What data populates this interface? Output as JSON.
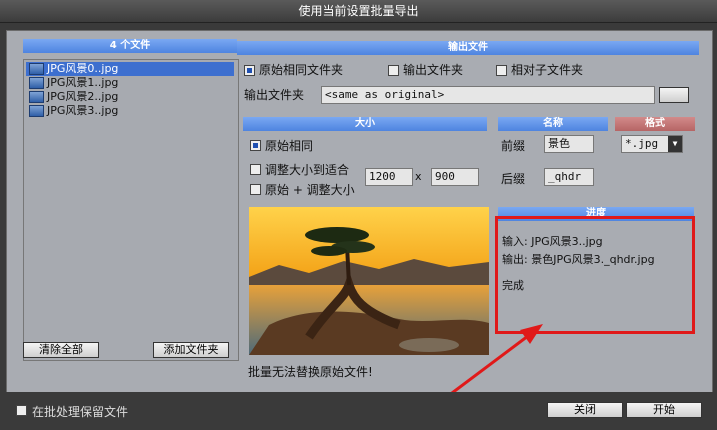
{
  "window": {
    "title": "使用当前设置批量导出"
  },
  "files": {
    "header": "4 个文件",
    "items": [
      {
        "label": "JPG风景0..jpg",
        "selected": true
      },
      {
        "label": "JPG风景1..jpg",
        "selected": false
      },
      {
        "label": "JPG风景2..jpg",
        "selected": false
      },
      {
        "label": "JPG风景3..jpg",
        "selected": false
      }
    ],
    "clear_all": "清除全部",
    "add_folder": "添加文件夹"
  },
  "output": {
    "header": "输出文件",
    "opt_original": "原始相同文件夹",
    "opt_output": "输出文件夹",
    "opt_sub": "相对子文件夹",
    "folder_label": "输出文件夹",
    "folder_value": "<same as original>"
  },
  "size": {
    "header": "大小",
    "opt_same": "原始相同",
    "opt_fit": "调整大小到适合",
    "opt_orig_plus": "原始 + 调整大小",
    "width": "1200",
    "x": "x",
    "height": "900"
  },
  "name": {
    "header": "名称",
    "prefix_label": "前缀",
    "prefix_value": "景色",
    "suffix_label": "后缀",
    "suffix_value": "_qhdr"
  },
  "format": {
    "header": "格式",
    "value": "*.jpg"
  },
  "progress": {
    "header": "进度",
    "input": "输入: JPG风景3..jpg",
    "output": "输出: 景色JPG风景3._qhdr.jpg",
    "status": "完成"
  },
  "warning": "批量无法替换原始文件!",
  "footer": {
    "keep_label": "在批处理保留文件",
    "close": "关闭",
    "start": "开始"
  },
  "colors": {
    "header_blue": "#5a8fe8",
    "header_red": "#c07474",
    "annotation_red": "#e01919"
  }
}
